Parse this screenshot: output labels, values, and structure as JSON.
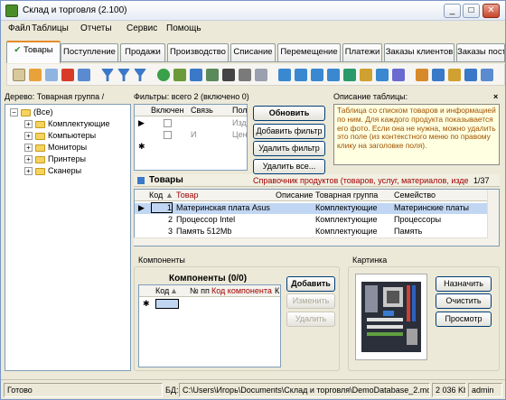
{
  "window": {
    "title": "Склад и торговля (2.100)"
  },
  "menu": [
    "Файл",
    "Таблицы",
    "Отчеты",
    "Сервис",
    "Помощь"
  ],
  "tabs": [
    "Товары",
    "Поступление",
    "Продажи",
    "Производство",
    "Списание",
    "Перемещение",
    "Платежи",
    "Заказы клиентов",
    "Заказы поставщ"
  ],
  "tree": {
    "header": "Дерево: Товарная группа /",
    "root": "(Все)",
    "items": [
      "Комплектующие",
      "Компьютеры",
      "Мониторы",
      "Принтеры",
      "Сканеры"
    ]
  },
  "filters": {
    "header": "Фильтры: всего 2 (включено 0)",
    "columns": [
      "Включен",
      "Связь",
      "Пол"
    ],
    "rows": [
      {
        "link": "",
        "field": "Изд"
      },
      {
        "link": "И",
        "field": "Цен"
      }
    ],
    "buttons": {
      "refresh": "Обновить",
      "add": "Добавить фильтр",
      "delete": "Удалить фильтр",
      "delete_all": "Удалить все..."
    }
  },
  "description": {
    "header": "Описание таблицы:",
    "text": "Таблица со списком товаров и информацией по ним. Для каждого продукта показывается его фото. Если она не нужна, можно удалить это поле (из контекстного меню по правому клику на заголовке поля)."
  },
  "products": {
    "title": "Товары",
    "subtitle": "Справочник продуктов (товаров, услуг, материалов, изде",
    "counter": "1/37",
    "columns": [
      "Код",
      "Товар",
      "Описание",
      "Товарная группа",
      "Семейство"
    ],
    "rows": [
      {
        "code": "1",
        "name": "Материнская плата Asus",
        "desc": "",
        "group": "Комплектующие",
        "family": "Материнские платы"
      },
      {
        "code": "2",
        "name": "Процессор Intel",
        "desc": "",
        "group": "Комплектующие",
        "family": "Процессоры"
      },
      {
        "code": "3",
        "name": "Память 512Mb",
        "desc": "",
        "group": "Комплектующие",
        "family": "Память"
      }
    ]
  },
  "components": {
    "tab": "Компоненты",
    "title": "Компоненты (0/0)",
    "columns": [
      "Код",
      "№ пп",
      "Код компонента",
      "К"
    ],
    "buttons": {
      "add": "Добавить",
      "edit": "Изменить",
      "delete": "Удалить"
    }
  },
  "picture": {
    "tab": "Картинка",
    "buttons": {
      "assign": "Назначить",
      "clear": "Очистить",
      "view": "Просмотр"
    }
  },
  "status": {
    "ready": "Готово",
    "db_label": "БД:",
    "db_path": "C:\\Users\\Игорь\\Documents\\Склад и торговля\\DemoDatabase_2.mdb",
    "size": "2 036 Kb",
    "user": "admin"
  }
}
